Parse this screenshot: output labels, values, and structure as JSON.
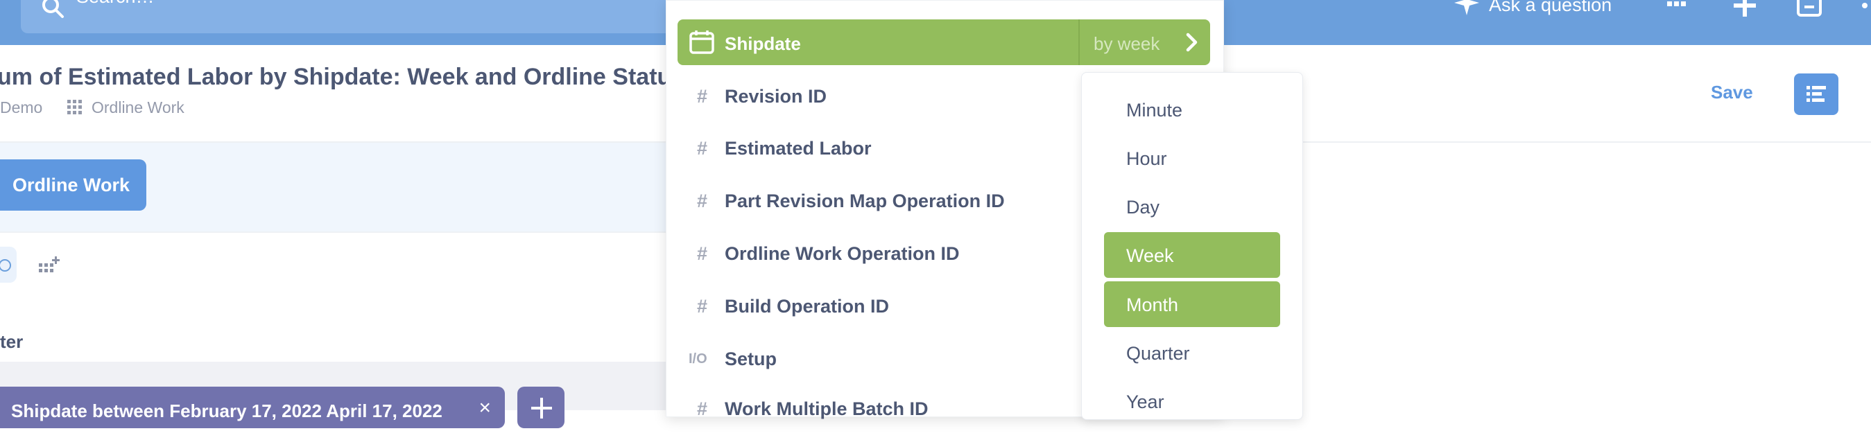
{
  "topbar": {
    "search_placeholder": "Search…",
    "ask_label": "Ask a question",
    "accent": "#6b9fdc"
  },
  "header": {
    "title": "um of Estimated Labor by Shipdate: Week and Ordline Status",
    "breadcrumb_collection": "Demo",
    "breadcrumb_table": "Ordline Work",
    "save_label": "Save"
  },
  "notebook": {
    "source_label": "Ordline Work",
    "filter_section_label": "ter",
    "filter_pill_label": "Shipdate between February 17, 2022 April 17, 2022",
    "filter_remove_glyph": "×"
  },
  "column_picker": {
    "selected": {
      "name": "Shipdate",
      "bucket_label": "by week",
      "icon": "calendar-icon"
    },
    "columns": [
      {
        "name": "Revision ID",
        "icon": "#"
      },
      {
        "name": "Estimated Labor",
        "icon": "#"
      },
      {
        "name": "Part Revision Map Operation ID",
        "icon": "#"
      },
      {
        "name": "Ordline Work Operation ID",
        "icon": "#"
      },
      {
        "name": "Build Operation ID",
        "icon": "#"
      },
      {
        "name": "Setup",
        "icon": "I/O"
      },
      {
        "name": "Work Multiple Batch ID",
        "icon": "#"
      }
    ],
    "highlight_color": "#93bd5c"
  },
  "bucket_menu": {
    "options": [
      {
        "label": "Minute",
        "active": false
      },
      {
        "label": "Hour",
        "active": false
      },
      {
        "label": "Day",
        "active": false
      },
      {
        "label": "Week",
        "active": true
      },
      {
        "label": "Month",
        "active": true
      },
      {
        "label": "Quarter",
        "active": false
      },
      {
        "label": "Year",
        "active": false
      }
    ]
  }
}
